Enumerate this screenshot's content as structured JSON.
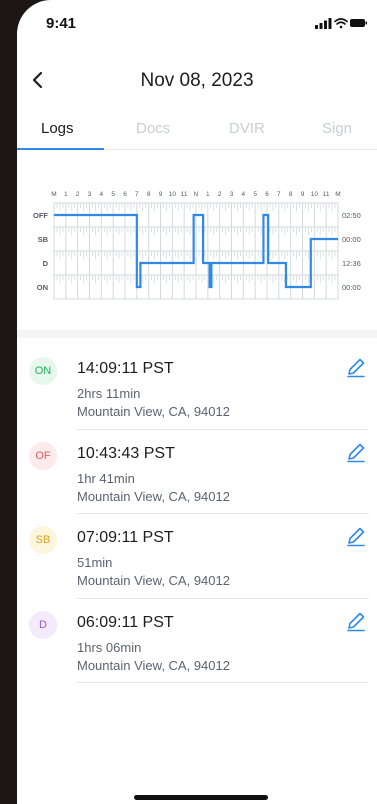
{
  "status_bar": {
    "time": "9:41"
  },
  "header": {
    "title": "Nov 08, 2023"
  },
  "tabs": [
    {
      "label": "Logs",
      "active": true
    },
    {
      "label": "Docs",
      "active": false
    },
    {
      "label": "DVIR",
      "active": false
    },
    {
      "label": "Sign",
      "active": false
    }
  ],
  "chart_data": {
    "type": "line",
    "x_ticks": [
      "M",
      "1",
      "2",
      "3",
      "4",
      "5",
      "6",
      "7",
      "8",
      "9",
      "10",
      "11",
      "N",
      "1",
      "2",
      "3",
      "4",
      "5",
      "6",
      "7",
      "8",
      "9",
      "10",
      "11",
      "M"
    ],
    "rows": [
      "OFF",
      "SB",
      "D",
      "ON"
    ],
    "totals": [
      "02:50",
      "00:00",
      "12:36",
      "00:00"
    ],
    "segments": [
      {
        "status": "OFF",
        "start": 0,
        "end": 7
      },
      {
        "status": "ON",
        "start": 7,
        "end": 7.3
      },
      {
        "status": "D",
        "start": 7.3,
        "end": 11.8
      },
      {
        "status": "OFF",
        "start": 11.8,
        "end": 12.6
      },
      {
        "status": "D",
        "start": 12.6,
        "end": 13.15
      },
      {
        "status": "ON",
        "start": 13.15,
        "end": 13.3
      },
      {
        "status": "D",
        "start": 13.3,
        "end": 17.7
      },
      {
        "status": "OFF",
        "start": 17.7,
        "end": 18.1
      },
      {
        "status": "D",
        "start": 18.1,
        "end": 19.6
      },
      {
        "status": "ON",
        "start": 19.6,
        "end": 21.7
      },
      {
        "status": "SB",
        "start": 21.7,
        "end": 24
      }
    ],
    "colors": {
      "line": "#2e8ae6",
      "grid": "#d4d8de",
      "label": "#555b66"
    }
  },
  "logs": [
    {
      "badge": "ON",
      "badge_color": "#27ae60",
      "badge_bg": "#e6f7ec",
      "time": "14:09:11 PST",
      "duration": "2hrs 11min",
      "location": "Mountain View, CA, 94012"
    },
    {
      "badge": "OF",
      "badge_color": "#e25c5c",
      "badge_bg": "#fdeaea",
      "time": "10:43:43 PST",
      "duration": "1hr 41min",
      "location": "Mountain View, CA, 94012"
    },
    {
      "badge": "SB",
      "badge_color": "#d9a321",
      "badge_bg": "#fdf5dc",
      "time": "07:09:11 PST",
      "duration": "51min",
      "location": "Mountain View, CA, 94012"
    },
    {
      "badge": "D",
      "badge_color": "#9b59d6",
      "badge_bg": "#f3eafb",
      "time": "06:09:11 PST",
      "duration": "1hrs 06min",
      "location": "Mountain View, CA, 94012"
    }
  ],
  "icons": {
    "back": "chevron-left-icon",
    "edit": "pencil-icon",
    "signal": "signal-icon",
    "wifi": "wifi-icon",
    "battery": "battery-icon"
  },
  "accent_color": "#2e8ae6"
}
